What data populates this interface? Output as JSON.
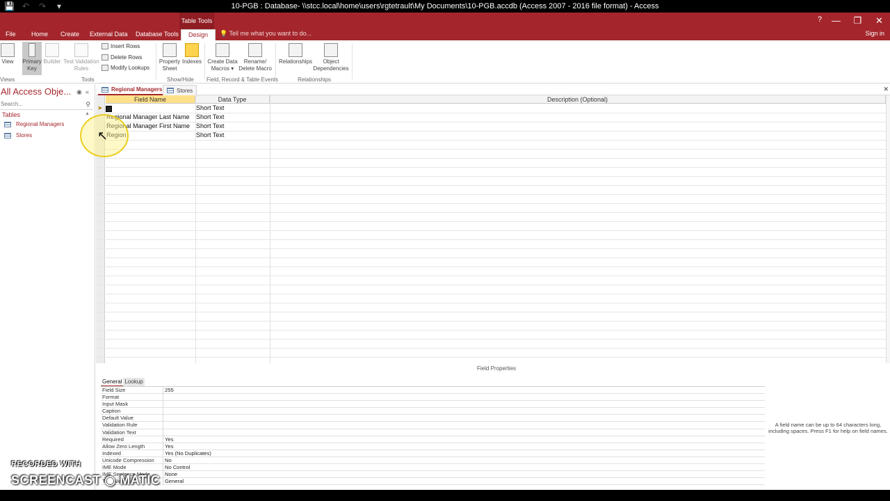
{
  "window": {
    "title": "10-PGB : Database- \\\\stcc.local\\home\\users\\rgtetrault\\My Documents\\10-PGB.accdb (Access 2007 - 2016 file format) - Access",
    "context_tab": "Table Tools",
    "help": "?",
    "sign_in": "Sign in"
  },
  "tabs": [
    {
      "label": "File"
    },
    {
      "label": "Home"
    },
    {
      "label": "Create"
    },
    {
      "label": "External Data"
    },
    {
      "label": "Database Tools"
    },
    {
      "label": "Design"
    }
  ],
  "tell_me": "Tell me what you want to do...",
  "ribbon": {
    "view": "View",
    "primary_key": "Primary Key",
    "builder": "Builder",
    "test_validation": "Test Validation Rules",
    "insert_rows": "Insert Rows",
    "delete_rows": "Delete Rows",
    "modify_lookups": "Modify Lookups",
    "property_sheet": "Property Sheet",
    "indexes": "Indexes",
    "create_data_macros": "Create Data Macros ▾",
    "rename_delete_macro": "Rename/ Delete Macro",
    "relationships": "Relationships",
    "object_dependencies": "Object Dependencies",
    "groups": {
      "views": "Views",
      "tools": "Tools",
      "show_hide": "Show/Hide",
      "field_events": "Field, Record & Table Events",
      "relationships": "Relationships"
    }
  },
  "nav": {
    "title": "All Access Obje...",
    "search_placeholder": "Search...",
    "group": "Tables",
    "items": [
      {
        "label": "Regional Managers"
      },
      {
        "label": "Stores"
      }
    ]
  },
  "doc_tabs": [
    {
      "label": "Regional Managers"
    },
    {
      "label": "Stores"
    }
  ],
  "grid": {
    "headers": {
      "field_name": "Field Name",
      "data_type": "Data Type",
      "description": "Description (Optional)"
    },
    "rows": [
      {
        "field": "",
        "type": "Short Text"
      },
      {
        "field": "Regional Manager Last Name",
        "type": "Short Text"
      },
      {
        "field": "Regional Manager First Name",
        "type": "Short Text"
      },
      {
        "field": "Region",
        "type": "Short Text"
      }
    ]
  },
  "field_properties": {
    "label": "Field Properties",
    "tabs": [
      {
        "label": "General"
      },
      {
        "label": "Lookup"
      }
    ],
    "rows": [
      {
        "key": "Field Size",
        "value": "255"
      },
      {
        "key": "Format",
        "value": ""
      },
      {
        "key": "Input Mask",
        "value": ""
      },
      {
        "key": "Caption",
        "value": ""
      },
      {
        "key": "Default Value",
        "value": ""
      },
      {
        "key": "Validation Rule",
        "value": ""
      },
      {
        "key": "Validation Text",
        "value": ""
      },
      {
        "key": "Required",
        "value": "Yes"
      },
      {
        "key": "Allow Zero Length",
        "value": "Yes"
      },
      {
        "key": "Indexed",
        "value": "Yes (No Duplicates)"
      },
      {
        "key": "Unicode Compression",
        "value": "No"
      },
      {
        "key": "IME Mode",
        "value": "No Control"
      },
      {
        "key": "IME Sentence Mode",
        "value": "None"
      },
      {
        "key": "Text Align",
        "value": "General"
      }
    ],
    "help": "A field name can be up to 64 characters long, including spaces. Press F1 for help on field names."
  },
  "watermark": {
    "line1": "RECORDED WITH",
    "line2": "SCREENCAST ◉ MATIC"
  }
}
